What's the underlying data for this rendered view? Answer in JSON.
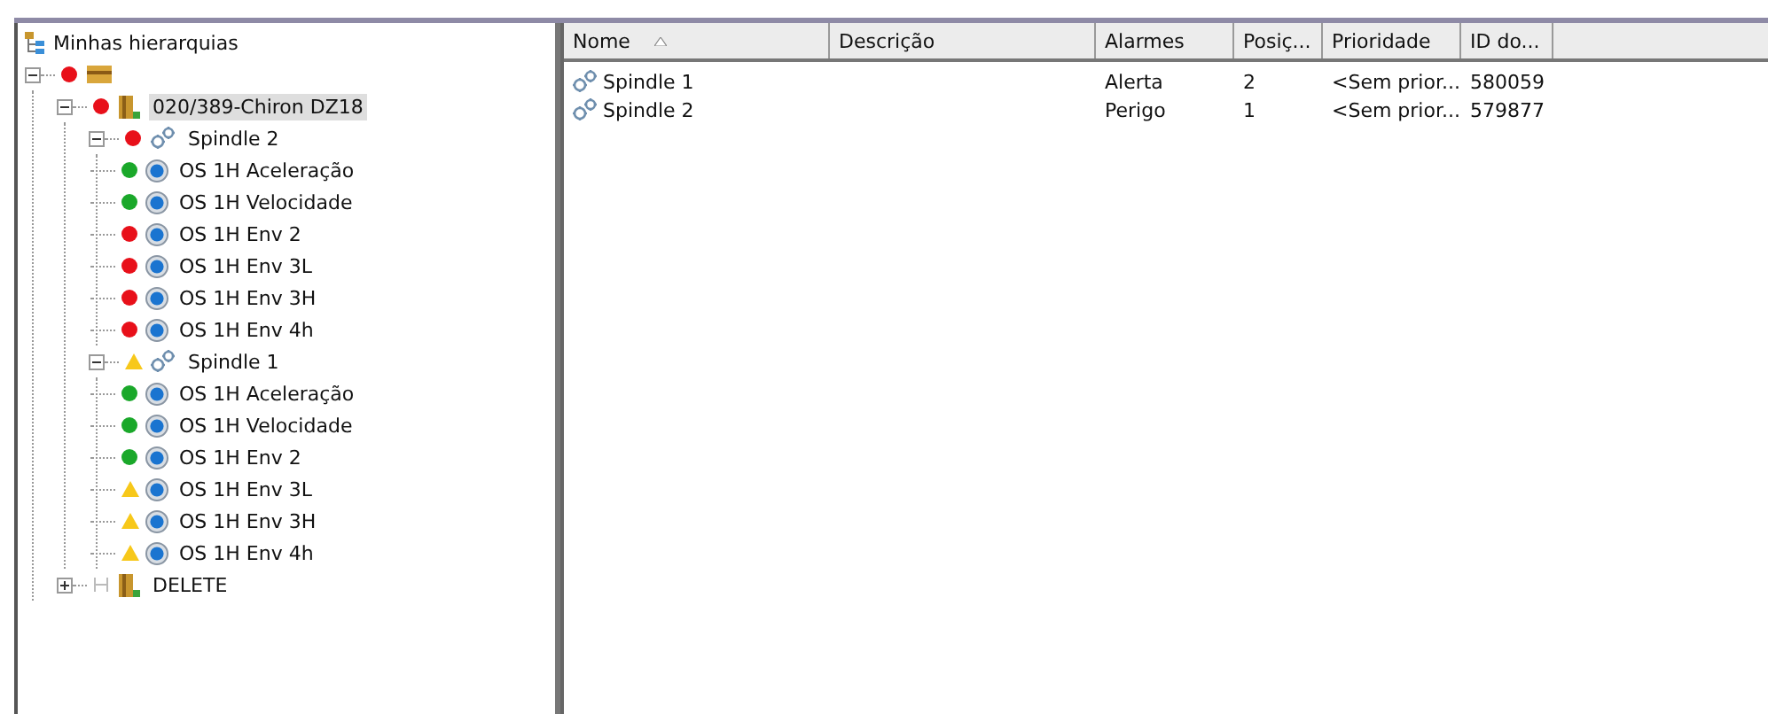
{
  "tree": {
    "title": "Minhas hierarquias",
    "items": [
      {
        "kind": "folder",
        "status": {
          "kind": "dot",
          "color": "#e8101a"
        },
        "expanded": true,
        "selected": false,
        "children": [
          {
            "kind": "machine",
            "status": {
              "kind": "dot",
              "color": "#e8101a"
            },
            "label": "020/389-Chiron DZ18",
            "expanded": true,
            "selected": true,
            "children": [
              {
                "kind": "spindle",
                "status": {
                  "kind": "dot",
                  "color": "#e8101a"
                },
                "label": "Spindle 2",
                "expanded": true,
                "selected": false,
                "children": [
                  {
                    "kind": "point",
                    "status": {
                      "kind": "dot",
                      "color": "#1aa82a"
                    },
                    "label": "OS 1H Aceleração",
                    "selected": false
                  },
                  {
                    "kind": "point",
                    "status": {
                      "kind": "dot",
                      "color": "#1aa82a"
                    },
                    "label": "OS 1H Velocidade",
                    "selected": false
                  },
                  {
                    "kind": "point",
                    "status": {
                      "kind": "dot",
                      "color": "#e8101a"
                    },
                    "label": "OS 1H Env 2",
                    "selected": false
                  },
                  {
                    "kind": "point",
                    "status": {
                      "kind": "dot",
                      "color": "#e8101a"
                    },
                    "label": "OS 1H Env 3L",
                    "selected": false
                  },
                  {
                    "kind": "point",
                    "status": {
                      "kind": "dot",
                      "color": "#e8101a"
                    },
                    "label": "OS 1H Env 3H",
                    "selected": false
                  },
                  {
                    "kind": "point",
                    "status": {
                      "kind": "dot",
                      "color": "#e8101a"
                    },
                    "label": "OS 1H Env 4h",
                    "selected": false
                  }
                ]
              },
              {
                "kind": "spindle",
                "status": {
                  "kind": "warning",
                  "color": "#f7c81a"
                },
                "label": "Spindle 1",
                "expanded": true,
                "selected": false,
                "children": [
                  {
                    "kind": "point",
                    "status": {
                      "kind": "dot",
                      "color": "#1aa82a"
                    },
                    "label": "OS 1H Aceleração",
                    "selected": false
                  },
                  {
                    "kind": "point",
                    "status": {
                      "kind": "dot",
                      "color": "#1aa82a"
                    },
                    "label": "OS 1H Velocidade",
                    "selected": false
                  },
                  {
                    "kind": "point",
                    "status": {
                      "kind": "dot",
                      "color": "#1aa82a"
                    },
                    "label": "OS 1H Env 2",
                    "selected": false
                  },
                  {
                    "kind": "point",
                    "status": {
                      "kind": "warning",
                      "color": "#f7c81a"
                    },
                    "label": "OS 1H Env 3L",
                    "selected": false
                  },
                  {
                    "kind": "point",
                    "status": {
                      "kind": "warning",
                      "color": "#f7c81a"
                    },
                    "label": "OS 1H Env 3H",
                    "selected": false
                  },
                  {
                    "kind": "point",
                    "status": {
                      "kind": "warning",
                      "color": "#f7c81a"
                    },
                    "label": "OS 1H Env 4h",
                    "selected": false
                  }
                ]
              }
            ]
          },
          {
            "kind": "machine",
            "status": {
              "kind": "inactive"
            },
            "label": "DELETE",
            "expanded": false,
            "selected": false
          }
        ]
      }
    ]
  },
  "table": {
    "columns": [
      {
        "label": "Nome",
        "sorted": true
      },
      {
        "label": "Descrição",
        "sorted": false
      },
      {
        "label": "Alarmes",
        "sorted": false
      },
      {
        "label": "Posiç...",
        "sorted": false
      },
      {
        "label": "Prioridade",
        "sorted": false
      },
      {
        "label": "ID do...",
        "sorted": false
      }
    ],
    "rows": [
      {
        "kind": "spindle",
        "cells": [
          "Spindle 1",
          "",
          "Alerta",
          "2",
          "<Sem prior...",
          "580059"
        ]
      },
      {
        "kind": "spindle",
        "cells": [
          "Spindle 2",
          "",
          "Perigo",
          "1",
          "<Sem prior...",
          "579877"
        ]
      }
    ]
  }
}
